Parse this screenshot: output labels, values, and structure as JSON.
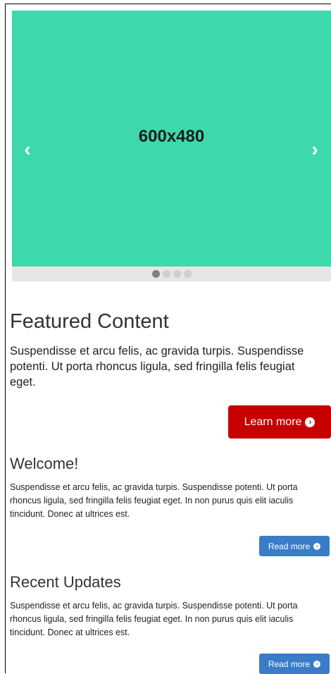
{
  "carousel": {
    "slide_label": "600x480",
    "slide_color": "#3dd9ad",
    "prev_icon": "chevron-left-icon",
    "next_icon": "chevron-right-icon",
    "indicator_count": 4,
    "active_index": 0
  },
  "featured": {
    "title": "Featured Content",
    "text": "Suspendisse et arcu felis, ac gravida turpis. Suspendisse potenti. Ut porta rhoncus ligula, sed fringilla felis feugiat eget.",
    "button_label": "Learn more",
    "button_icon": "chevron-circle-right-icon",
    "button_color": "#c60000"
  },
  "welcome": {
    "title": "Welcome!",
    "text": "Suspendisse et arcu felis, ac gravida turpis. Suspendisse potenti. Ut porta rhoncus ligula, sed fringilla felis feugiat eget. In non purus quis elit iaculis tincidunt. Donec at ultrices est.",
    "button_label": "Read more",
    "button_color": "#3a7cc7"
  },
  "recent": {
    "title": "Recent Updates",
    "text": "Suspendisse et arcu felis, ac gravida turpis. Suspendisse potenti. Ut porta rhoncus ligula, sed fringilla felis feugiat eget. In non purus quis elit iaculis tincidunt. Donec at ultrices est.",
    "button_label": "Read more",
    "button_color": "#3a7cc7"
  }
}
